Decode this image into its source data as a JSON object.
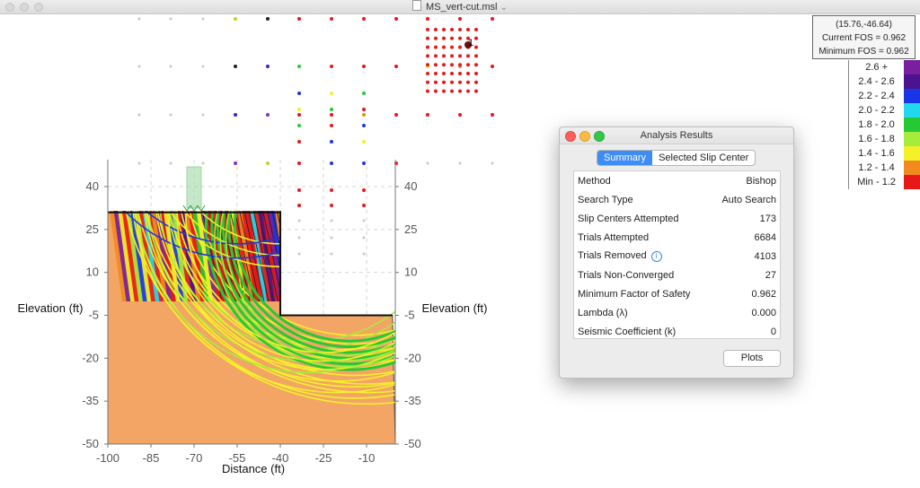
{
  "window": {
    "title": "MS_vert-cut.msl",
    "title_chevron": "⌄"
  },
  "chart_data": {
    "type": "scatter",
    "xlabel": "Distance (ft)",
    "ylabel_left": "Elevation (ft)",
    "ylabel_right": "Elevation (ft)",
    "x_ticks": [
      "-100",
      "-85",
      "-70",
      "-55",
      "-40",
      "-25",
      "-10"
    ],
    "y_ticks": [
      "40",
      "25",
      "10",
      "-5",
      "-20",
      "-35",
      "-50"
    ],
    "xlim": [
      -100,
      -1
    ],
    "ylim": [
      -50,
      48
    ],
    "grid": true,
    "slope_surface": [
      [
        -100,
        31
      ],
      [
        -40,
        31
      ],
      [
        -40,
        -5
      ],
      [
        -1,
        -5
      ]
    ],
    "load_x": -70,
    "critical_slip_marker": "1"
  },
  "tooltip": {
    "coords": "(15.76,-46.64)",
    "current_fos": "Current FOS = 0.962",
    "minimum_fos": "Minimum FOS = 0.962"
  },
  "legend": {
    "items": [
      {
        "label": "2.6 +",
        "color": "#7a1fa0"
      },
      {
        "label": "2.4 - 2.6",
        "color": "#4b1390"
      },
      {
        "label": "2.2 - 2.4",
        "color": "#1a35e8"
      },
      {
        "label": "2.0 - 2.2",
        "color": "#21d9ee"
      },
      {
        "label": "1.8 - 2.0",
        "color": "#26c934"
      },
      {
        "label": "1.6 - 1.8",
        "color": "#a6ec3a"
      },
      {
        "label": "1.4 - 1.6",
        "color": "#f4f128"
      },
      {
        "label": "1.2 - 1.4",
        "color": "#f28a1d"
      },
      {
        "label": "Min - 1.2",
        "color": "#e81818"
      }
    ]
  },
  "dialog": {
    "title": "Analysis Results",
    "tabs": {
      "summary": "Summary",
      "selected": "Selected Slip Center"
    },
    "rows": [
      {
        "label": "Method",
        "value": "Bishop"
      },
      {
        "label": "Search Type",
        "value": "Auto Search"
      },
      {
        "label": "Slip Centers Attempted",
        "value": "173"
      },
      {
        "label": "Trials Attempted",
        "value": "6684"
      },
      {
        "label": "Trials Removed",
        "value": "4103"
      },
      {
        "label": "Trials Non-Converged",
        "value": "27"
      },
      {
        "label": "Minimum Factor of Safety",
        "value": "0.962"
      },
      {
        "label": "Lambda (λ)",
        "value": "0.000"
      },
      {
        "label": "Seismic Coefficient (k)",
        "value": "0"
      }
    ],
    "plots_label": "Plots",
    "info_icon_glyph": "i"
  }
}
